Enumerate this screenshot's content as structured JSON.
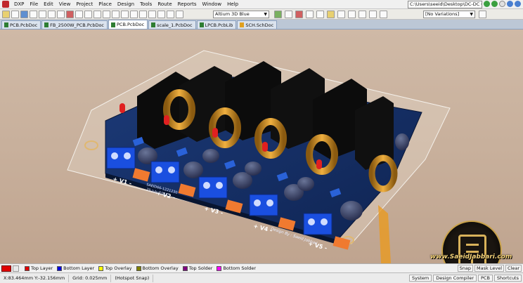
{
  "menu": {
    "items": [
      "DXP",
      "File",
      "Edit",
      "View",
      "Project",
      "Place",
      "Design",
      "Tools",
      "Route",
      "Reports",
      "Window",
      "Help"
    ],
    "path": "C:\\Users\\seeid\\Desktop\\DC-DC Co"
  },
  "toolbar": {
    "view_mode": "Altium 3D Blue",
    "variations": "[No Variations]"
  },
  "tabs": [
    {
      "label": "PCB.PcbDoc",
      "type": "pcb"
    },
    {
      "label": "FB_2500W_PCB.PcbDoc",
      "type": "pcb"
    },
    {
      "label": "PCB.PcbDoc",
      "type": "pcb",
      "active": true
    },
    {
      "label": "scale_1.PcbDoc",
      "type": "pcb"
    },
    {
      "label": "LPCB.PcbLib",
      "type": "pcb"
    },
    {
      "label": "SCH.SchDoc",
      "type": "sch"
    }
  ],
  "pcb": {
    "outputs": [
      "+ V1 -",
      "+ V2 -",
      "+ V3 -",
      "+ V4 -",
      "+ V5 -"
    ],
    "board_code": "SAEID66-1221230",
    "board_date": "25 July 2017",
    "credit": "Design By : Saeid Jabbari"
  },
  "branding": {
    "site": "www.SaeidJabbari.com"
  },
  "layers": {
    "items": [
      {
        "label": "Top Layer",
        "color": "#e00000"
      },
      {
        "label": "Bottom Layer",
        "color": "#0000e0"
      },
      {
        "label": "Top Overlay",
        "color": "#ffff00"
      },
      {
        "label": "Bottom Overlay",
        "color": "#808000"
      },
      {
        "label": "Top Solder",
        "color": "#800080"
      },
      {
        "label": "Bottom Solder",
        "color": "#ff00ff"
      }
    ],
    "snap": "Snap",
    "mask_level": "Mask Level",
    "clear": "Clear"
  },
  "status": {
    "coords": "X:83.464mm Y:-32.156mm",
    "grid": "Grid: 0.025mm",
    "snap_mode": "(Hotspot Snap)",
    "panels": [
      "System",
      "Design Compiler",
      "PCB",
      "Shortcuts"
    ]
  }
}
